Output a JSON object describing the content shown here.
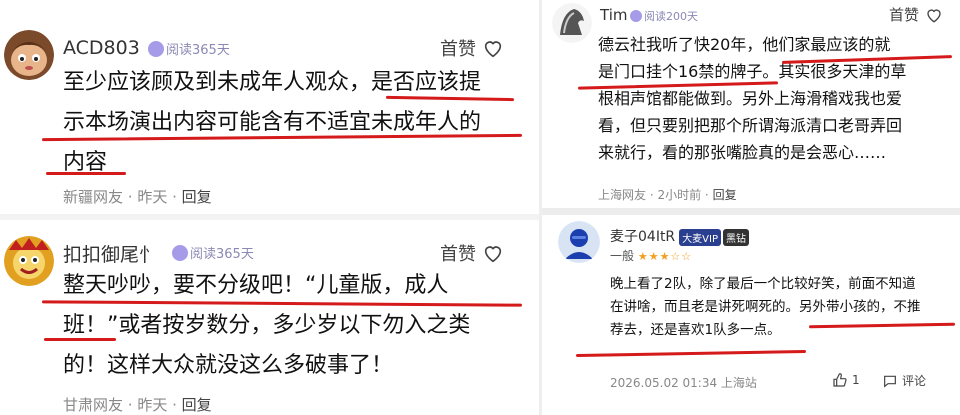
{
  "comments": [
    {
      "user": "ACD803",
      "badge": "阅读365天",
      "likes": "首赞",
      "lines": [
        "至少应该顾及到未成年人观众，是否应该提",
        "示本场演出内容可能含有不适宜未成年人的",
        "内容"
      ],
      "location": "新疆网友",
      "time": "昨天",
      "reply": "回复"
    },
    {
      "user": "扣扣御尾忄",
      "badge": "阅读365天",
      "likes": "首赞",
      "lines": [
        "整天吵吵，要不分级吧！“儿童版，成人",
        "班！”或者按岁数分，多少岁以下勿入之类",
        "的！这样大众就没这么多破事了！"
      ],
      "location": "甘肃网友",
      "time": "昨天",
      "reply": "回复"
    },
    {
      "user": "Tim",
      "badge": "阅读200天",
      "likes": "首赞",
      "lines": [
        "德云社我听了快20年，他们家最应该的就",
        "是门口挂个16禁的牌子。其实很多天津的草",
        "根相声馆都能做到。另外上海滑稽戏我也爱",
        "看，但只要别把那个所谓海派清口老哥弄回",
        "来就行，看的那张嘴脸真的是会恶心……"
      ],
      "location": "上海网友",
      "time": "2小时前",
      "reply": "回复"
    },
    {
      "user": "麦子04ItR",
      "vip": "大麦VIP",
      "tag": "黑钻",
      "level": "一般",
      "lines": [
        "晚上看了2队，除了最后一个比较好笑，前面不知道",
        "在讲啥，而且老是讲死啊死的。另外带小孩的，不推",
        "荐去，还是喜欢1队多一点。"
      ],
      "date": "2026.05.02 01:34 上海站",
      "like_count": "1",
      "comment_label": "评论"
    }
  ]
}
